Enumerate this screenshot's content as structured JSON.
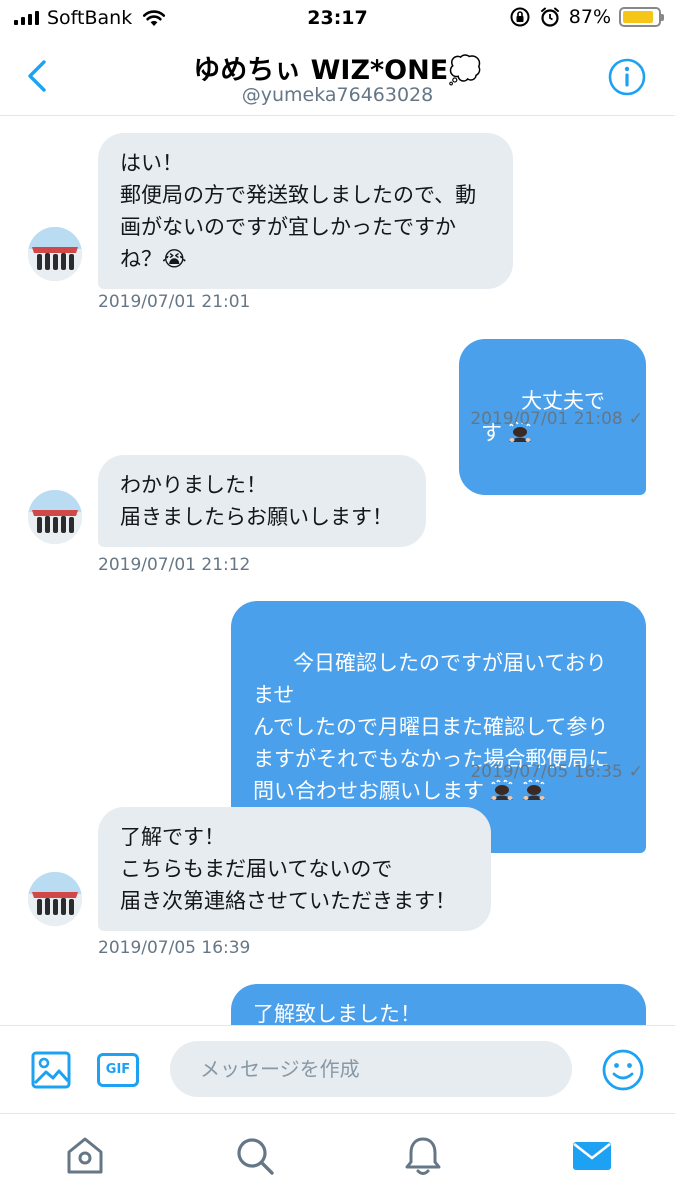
{
  "status_bar": {
    "carrier": "SoftBank",
    "time": "23:17",
    "battery": "87%",
    "battery_level": 0.87,
    "icons": [
      "signal-icon",
      "wifi-icon",
      "orientation-lock-icon",
      "alarm-icon",
      "battery-icon"
    ]
  },
  "header": {
    "title": "ゆめちぃ WIZ*ONE💭",
    "handle": "@yumeka76463028",
    "back_icon": "chevron-left-icon",
    "info_icon": "info-icon"
  },
  "messages": [
    {
      "direction": "in",
      "text": "はい！\n郵便局の方で発送致しましたので、動\n画がないのですが宜しかったですか\nね？😭",
      "time": "2019/07/01 21:01"
    },
    {
      "direction": "out",
      "text": "大丈夫です",
      "emoji": "bowing-person-emoji",
      "emoji_count": 1,
      "time": "2019/07/01 21:08",
      "read": "✓"
    },
    {
      "direction": "in",
      "text": "わかりました！\n届きましたらお願いします！",
      "time": "2019/07/01 21:12"
    },
    {
      "direction": "out",
      "text": "今日確認したのですが届いておりませ\nんでしたので月曜日また確認して参り\nますがそれでもなかった場合郵便局に\n問い合わせお願いします",
      "emoji": "bowing-person-emoji",
      "emoji_count": 2,
      "time": "2019/07/05 16:35",
      "read": "✓"
    },
    {
      "direction": "in",
      "text": "了解です！\nこちらもまだ届いてないので\n届き次第連絡させていただきます！",
      "time": "2019/07/05 16:39"
    },
    {
      "direction": "out",
      "text": "了解致しました！"
    }
  ],
  "composer": {
    "placeholder": "メッセージを作成",
    "gif_label": "GIF",
    "media_icon": "image-icon",
    "emoji_icon": "smiley-icon"
  },
  "tabbar": {
    "tabs": [
      "home-icon",
      "search-icon",
      "notifications-icon",
      "messages-icon"
    ],
    "active": "messages-icon"
  },
  "colors": {
    "accent": "#1da1f2",
    "outgoing_bubble": "#4ba0eb",
    "incoming_bubble": "#e6ecf0",
    "muted_text": "#657786"
  }
}
